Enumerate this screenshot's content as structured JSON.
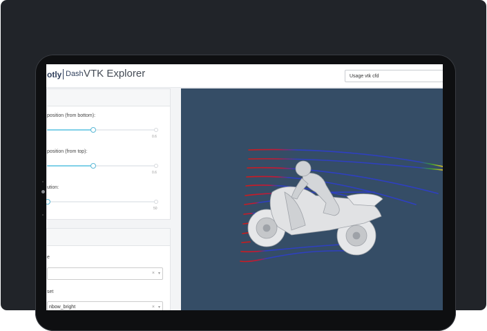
{
  "header": {
    "logo": "otly",
    "logo_dash": "Dash",
    "title": "VTK Explorer",
    "demo_select": "Usage vtk cfd"
  },
  "controls": {
    "slider1": {
      "label": "position (from bottom):",
      "max_label": "0.6",
      "value_fraction": 0.42
    },
    "slider2": {
      "label": "position (from top):",
      "max_label": "0.6",
      "value_fraction": 0.42
    },
    "slider3": {
      "label": "ution:",
      "max_label": "50",
      "value_fraction": 0.0
    }
  },
  "coloring": {
    "field_label": "e",
    "field_value": "",
    "preset_label": "set",
    "preset_value": "nbow_bright",
    "clear_glyph": "×",
    "arrow_glyph": "▾"
  },
  "colors": {
    "viewport_bg": "#354d66",
    "stream_blue": "#2e3fc2",
    "stream_red": "#d11a1a",
    "slider_accent": "#7fd0e8"
  }
}
